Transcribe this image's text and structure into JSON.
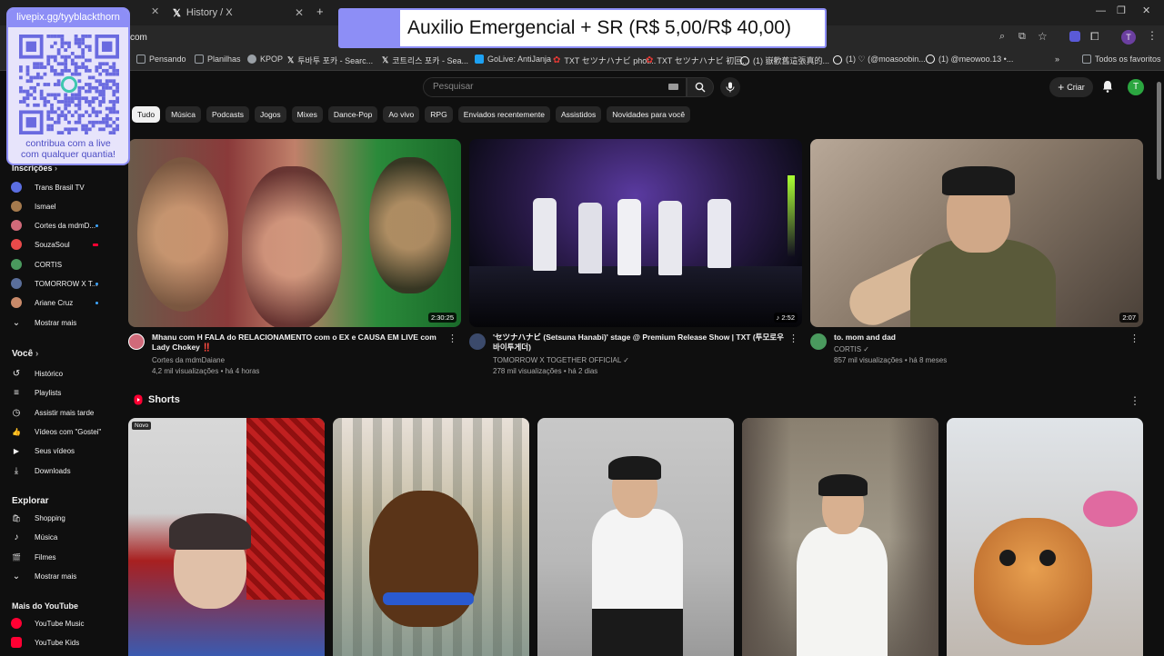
{
  "browser": {
    "tabs": [
      {
        "label": "History / X"
      }
    ],
    "address_fragment": "com",
    "bookmarks": [
      {
        "label": "Pensando",
        "color": "#9aa0a6"
      },
      {
        "label": "Planilhas",
        "color": "#9aa0a6"
      },
      {
        "label": "KPOP",
        "color": "#9aa0a6"
      },
      {
        "label": "투바투 포카 - Searc...",
        "color": "#ffffff"
      },
      {
        "label": "코트리스 포카 - Sea...",
        "color": "#ffffff"
      },
      {
        "label": "GoLive: AntiJanja",
        "color": "#1da1f2"
      },
      {
        "label": "TXT セツナハナビ phot...",
        "color": "#e53935"
      },
      {
        "label": "TXT セツナハナビ 初回...",
        "color": "#e53935"
      },
      {
        "label": "(1) 嶽歡舊這張真的...",
        "color": "#ffffff"
      },
      {
        "label": "(1) ♡ (@moasoobin...",
        "color": "#ffffff"
      },
      {
        "label": "(1) @meowoo.13 •...",
        "color": "#ffffff"
      },
      {
        "label": "Todos os favoritos",
        "color": "#9aa0a6"
      }
    ],
    "profile_initial": "T"
  },
  "overlay": {
    "donation_text": "Auxilio Emergencial + SR (R$ 5,00/R$ 40,00)",
    "qr_url": "livepix.gg/tyyblackthorn",
    "qr_caption_1": "contribua com a live",
    "qr_caption_2": "com qualquer quantia!",
    "accent": "#8d8ef6"
  },
  "topbar": {
    "search_placeholder": "Pesquisar",
    "create_label": "Criar",
    "avatar_initial": "T"
  },
  "chips": [
    "Tudo",
    "Música",
    "Podcasts",
    "Jogos",
    "Mixes",
    "Dance-Pop",
    "Ao vivo",
    "RPG",
    "Enviados recentemente",
    "Assistidos",
    "Novidades para você"
  ],
  "sidebar": {
    "subs_title": "Inscrições",
    "subs": [
      {
        "label": "Trans Brasil TV",
        "color": "#5b6ee1",
        "dot": false
      },
      {
        "label": "Ismael",
        "color": "#a57a4d",
        "dot": false
      },
      {
        "label": "Cortes da mdmD...",
        "color": "#d06a7a",
        "dot": true
      },
      {
        "label": "SouzaSoul",
        "color": "#e84a4a",
        "dot": true
      },
      {
        "label": "CORTIS",
        "color": "#4a9a5e",
        "dot": false
      },
      {
        "label": "TOMORROW X T...",
        "color": "#5a6e9a",
        "dot": true
      },
      {
        "label": "Ariane Cruz",
        "color": "#c98a6a",
        "dot": true
      }
    ],
    "subs_more": "Mostrar mais",
    "you_title": "Você",
    "you": [
      {
        "label": "Histórico",
        "icon": "history-icon",
        "glyph": "↺"
      },
      {
        "label": "Playlists",
        "icon": "playlist-icon",
        "glyph": "≡"
      },
      {
        "label": "Assistir mais tarde",
        "icon": "clock-icon",
        "glyph": "◷"
      },
      {
        "label": "Vídeos com \"Gostei\"",
        "icon": "thumb-up-icon",
        "glyph": "👍"
      },
      {
        "label": "Seus vídeos",
        "icon": "video-icon",
        "glyph": "▶"
      },
      {
        "label": "Downloads",
        "icon": "download-icon",
        "glyph": "⤓"
      }
    ],
    "explore_title": "Explorar",
    "explore": [
      {
        "label": "Shopping",
        "icon": "shopping-icon",
        "glyph": "🛍"
      },
      {
        "label": "Música",
        "icon": "music-icon",
        "glyph": "♪"
      },
      {
        "label": "Filmes",
        "icon": "film-icon",
        "glyph": "🎬"
      }
    ],
    "explore_more": "Mostrar mais",
    "more_yt_title": "Mais do YouTube",
    "more_yt": [
      {
        "label": "YouTube Music",
        "color": "#ff0033"
      },
      {
        "label": "YouTube Kids",
        "color": "#ff0033"
      }
    ]
  },
  "videos": [
    {
      "title": "Mhanu com H FALA do RELACIONAMENTO com o EX e CAUSA EM LIVE com Lady Chokey ‼️",
      "channel": "Cortes da mdmDaiane",
      "stats": "4,2 mil visualizações • há 4 horas",
      "duration": "2:30:25",
      "avatar_color": "#d06a7a"
    },
    {
      "title": "'セツナハナビ (Setsuna Hanabi)' stage @ Premium Release Show | TXT (투모로우바이투게더)",
      "channel": "TOMORROW X TOGETHER OFFICIAL ✓",
      "stats": "278 mil visualizações • há 2 dias",
      "duration": "2:52",
      "avatar_color": "#3b4a6b"
    },
    {
      "title": "to. mom and dad",
      "channel": "CORTIS ✓",
      "stats": "857 mil visualizações • há 8 meses",
      "duration": "2:07",
      "avatar_color": "#4a9a5e"
    }
  ],
  "shorts": {
    "title": "Shorts",
    "badge": "Novo"
  }
}
